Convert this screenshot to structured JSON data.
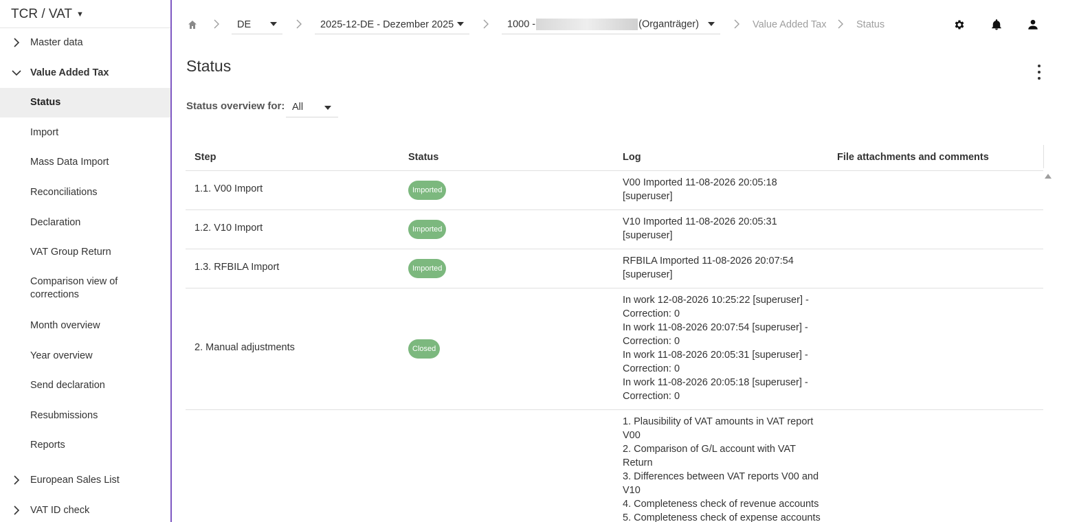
{
  "sidebar": {
    "app_title": "TCR / VAT",
    "items": [
      {
        "label": "Master data"
      },
      {
        "label": "Value Added Tax"
      },
      {
        "label": "Status"
      },
      {
        "label": "Import"
      },
      {
        "label": "Mass Data Import"
      },
      {
        "label": "Reconciliations"
      },
      {
        "label": "Declaration"
      },
      {
        "label": "VAT Group Return"
      },
      {
        "label": "Comparison view of corrections"
      },
      {
        "label": "Month overview"
      },
      {
        "label": "Year overview"
      },
      {
        "label": "Send declaration"
      },
      {
        "label": "Resubmissions"
      },
      {
        "label": "Reports"
      },
      {
        "label": "European Sales List"
      },
      {
        "label": "VAT ID check"
      }
    ]
  },
  "topbar": {
    "country": "DE",
    "period": "2025-12-DE - Dezember 2025",
    "company_prefix": "1000 -",
    "company_suffix": "(Organträger)",
    "crumb_vat": "Value Added Tax",
    "crumb_status": "Status",
    "icons": [
      "home-icon",
      "settings-icon",
      "bell-icon",
      "user-icon"
    ]
  },
  "page": {
    "title": "Status",
    "filter_label": "Status overview for:",
    "filter_value": "All"
  },
  "table": {
    "headers": [
      "Step",
      "Status",
      "Log",
      "File attachments and comments"
    ],
    "rows": [
      {
        "step": "1.1. V00 Import",
        "status": "Imported",
        "log": [
          "V00 Imported 11-08-2026 20:05:18",
          "[superuser]"
        ]
      },
      {
        "step": "1.2. V10 Import",
        "status": "Imported",
        "log": [
          "V10 Imported 11-08-2026 20:05:31",
          "[superuser]"
        ]
      },
      {
        "step": "1.3. RFBILA Import",
        "status": "Imported",
        "log": [
          "RFBILA Imported 11-08-2026 20:07:54",
          "[superuser]"
        ]
      },
      {
        "step": "2. Manual adjustments",
        "status": "Closed",
        "log": [
          "In work 12-08-2026 10:25:22 [superuser] -",
          "Correction: 0",
          "In work 11-08-2026 20:07:54 [superuser] -",
          "Correction: 0",
          "In work 11-08-2026 20:05:31 [superuser] -",
          "Correction: 0",
          "In work 11-08-2026 20:05:18 [superuser] -",
          "Correction: 0"
        ]
      },
      {
        "step": "",
        "status": "",
        "log": [
          "1. Plausibility of VAT amounts in VAT report",
          "V00",
          "2. Comparison of G/L account with VAT",
          "Return",
          "3. Differences between VAT reports V00 and",
          "V10",
          "4. Completeness check of revenue accounts",
          "5. Completeness check of expense accounts"
        ]
      }
    ]
  },
  "colors": {
    "badge_green": "#7cb87e",
    "sidebar_accent": "#7e57c2",
    "active_bg": "#eeeeee"
  }
}
